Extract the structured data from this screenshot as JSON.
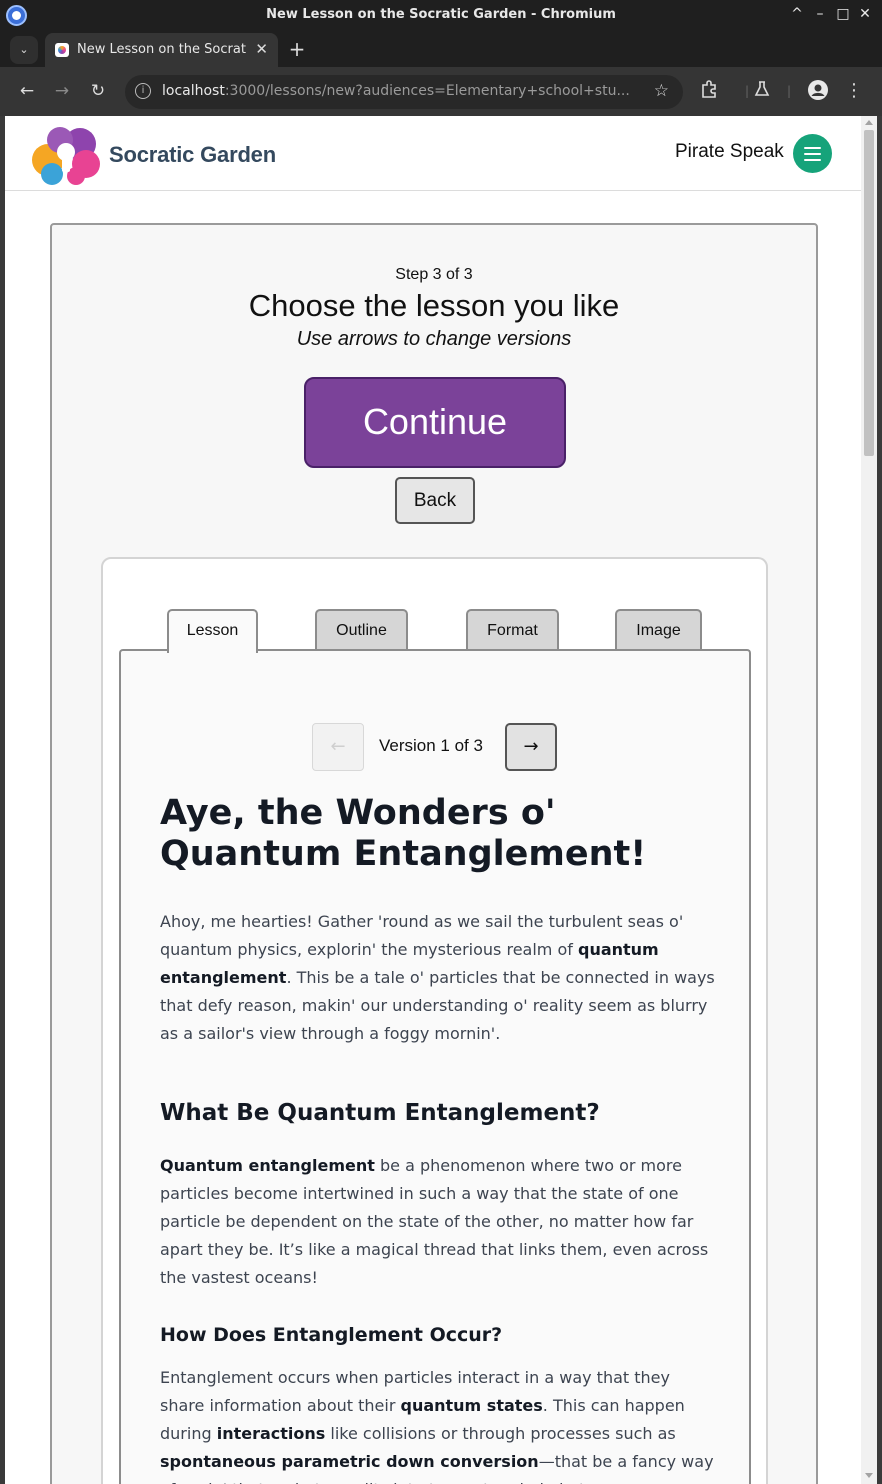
{
  "window": {
    "title": "New Lesson on the Socratic Garden - Chromium",
    "controls": [
      "^",
      "–",
      "□",
      "✕"
    ]
  },
  "tabs": {
    "active_title": "New Lesson on the Socratic Garden",
    "close": "✕",
    "new_tab": "+"
  },
  "toolbar": {
    "url_host": "localhost",
    "url_rest": ":3000/lessons/new?audiences=Elementary+school+stu...",
    "back": "←",
    "forward": "→",
    "reload": "↻",
    "star": "☆"
  },
  "header": {
    "logo_text": "Socratic Garden",
    "mode": "Pirate Speak"
  },
  "wizard": {
    "step": "Step 3 of 3",
    "heading": "Choose the lesson you like",
    "subheading": "Use arrows to change versions",
    "continue": "Continue",
    "back": "Back"
  },
  "lesson_tabs": [
    {
      "label": "Lesson",
      "active": true
    },
    {
      "label": "Outline",
      "active": false
    },
    {
      "label": "Format",
      "active": false
    },
    {
      "label": "Image",
      "active": false
    }
  ],
  "versions": {
    "prev": "←",
    "label": "Version 1 of 3",
    "next": "→",
    "prev_enabled": false
  },
  "lesson": {
    "title": "Aye, the Wonders o' Quantum Entanglement!",
    "intro": [
      {
        "t": "Ahoy, me hearties! Gather 'round as we sail the turbulent seas o' quantum physics, explorin' the mysterious realm of "
      },
      {
        "t": "quantum entanglement",
        "b": true
      },
      {
        "t": ". This be a tale o' particles that be connected in ways that defy reason, makin' our understanding o' reality seem as blurry as a sailor's view through a foggy mornin'."
      }
    ],
    "h2": "What Be Quantum Entanglement?",
    "p2": [
      {
        "t": "Quantum entanglement",
        "b": true
      },
      {
        "t": " be a phenomenon where two or more particles become intertwined in such a way that the state of one particle be dependent on the state of the other, no matter how far apart they be. It’s like a magical thread that links them, even across the vastest oceans!"
      }
    ],
    "h3": "How Does Entanglement Occur?",
    "p3": [
      {
        "t": "Entanglement occurs when particles interact in a way that they share information about their "
      },
      {
        "t": "quantum states",
        "b": true
      },
      {
        "t": ". This can happen during "
      },
      {
        "t": "interactions",
        "b": true
      },
      {
        "t": " like collisions or through processes such as "
      },
      {
        "t": "spontaneous parametric down conversion",
        "b": true
      },
      {
        "t": "—that be a fancy way of sayin' that a photon splits into two entangled photons."
      }
    ]
  },
  "colors": {
    "continue_bg": "#7b4299",
    "menu_btn": "#16a37a",
    "logo_text": "#34495e"
  }
}
